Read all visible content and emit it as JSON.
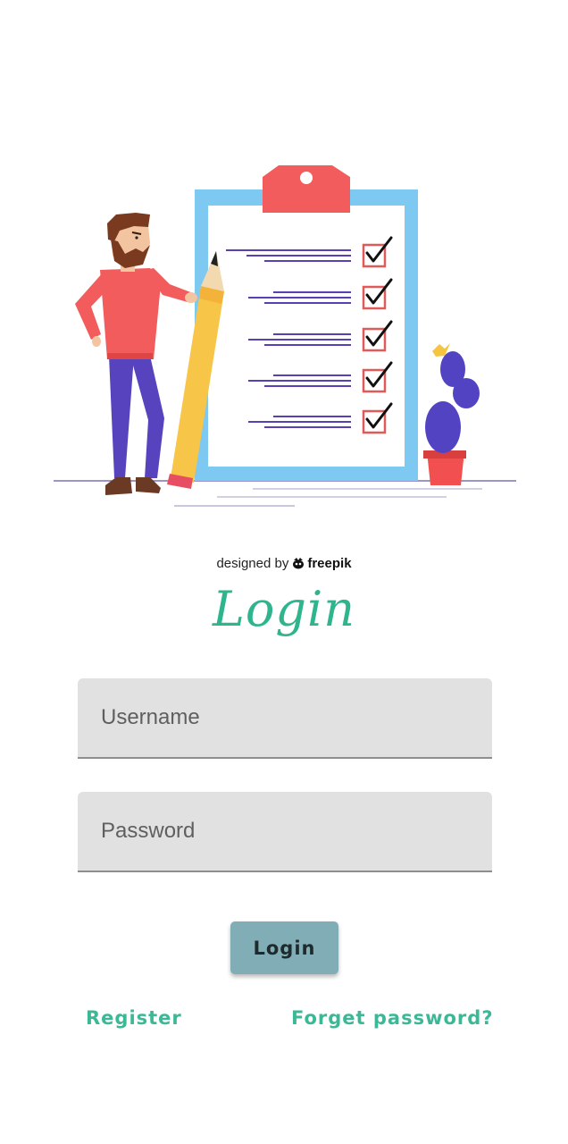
{
  "illustration": {
    "credit_prefix": "designed by",
    "credit_brand": "freepik",
    "icons": [
      "freepik-bee-icon"
    ]
  },
  "login_form": {
    "title": "Login",
    "username": {
      "placeholder": "Username",
      "value": ""
    },
    "password": {
      "placeholder": "Password",
      "value": ""
    },
    "submit_label": "Login",
    "register_label": "Register",
    "forget_password_label": "Forget password?"
  },
  "colors": {
    "accent": "#2eb58d",
    "link": "#3bb896",
    "button": "#81aeb6",
    "field_background": "#e1e1e1"
  }
}
